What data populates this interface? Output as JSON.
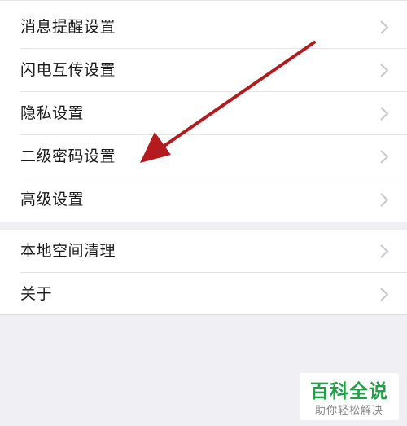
{
  "settings_group_1": {
    "items": [
      {
        "label": "消息提醒设置"
      },
      {
        "label": "闪电互传设置"
      },
      {
        "label": "隐私设置"
      },
      {
        "label": "二级密码设置"
      },
      {
        "label": "高级设置"
      }
    ]
  },
  "settings_group_2": {
    "items": [
      {
        "label": "本地空间清理"
      },
      {
        "label": "关于"
      }
    ]
  },
  "annotation": {
    "arrow_color": "#b51a1f",
    "icon": "arrow-icon"
  },
  "watermark": {
    "title": "百科全说",
    "subtitle": "助你轻松解决",
    "color": "#22a045"
  },
  "colors": {
    "background": "#efeff4",
    "row_background": "#ffffff",
    "chevron": "#c7c7cc"
  }
}
